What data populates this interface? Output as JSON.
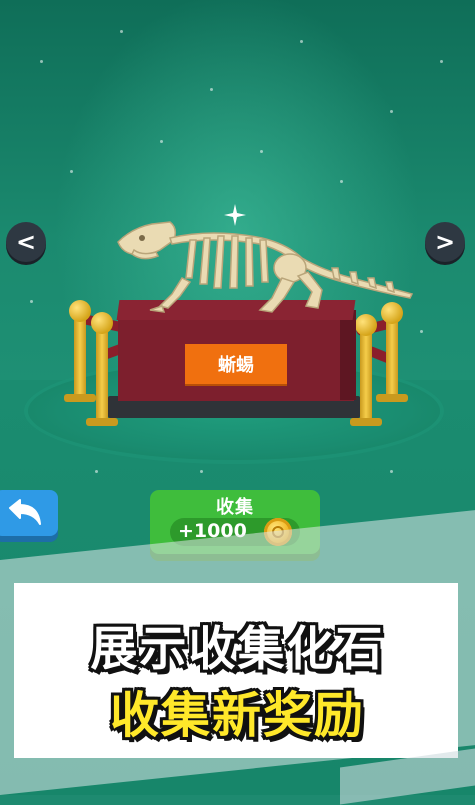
{
  "scene": {
    "fossil_label": "蜥蜴",
    "fossil_icon": "dinosaur-skeleton",
    "sparkle_icon": "sparkle-star"
  },
  "nav": {
    "prev_icon": "chevron-left-icon",
    "next_icon": "chevron-right-icon",
    "prev_glyph": "<",
    "next_glyph": ">"
  },
  "back_button": {
    "icon": "undo-arrow-icon"
  },
  "collect_button": {
    "label": "收集",
    "reward": "+1000",
    "coin_icon": "coin-icon"
  },
  "banner": {
    "line1": "展示收集化石",
    "line2": "收集新奖励"
  },
  "colors": {
    "background": "#1e8a70",
    "pedestal": "#7d1f2d",
    "label_plate": "#f0700f",
    "collect_button": "#3fbd3c",
    "back_button": "#2f9ae6",
    "banner_line2": "#ffe82a"
  }
}
